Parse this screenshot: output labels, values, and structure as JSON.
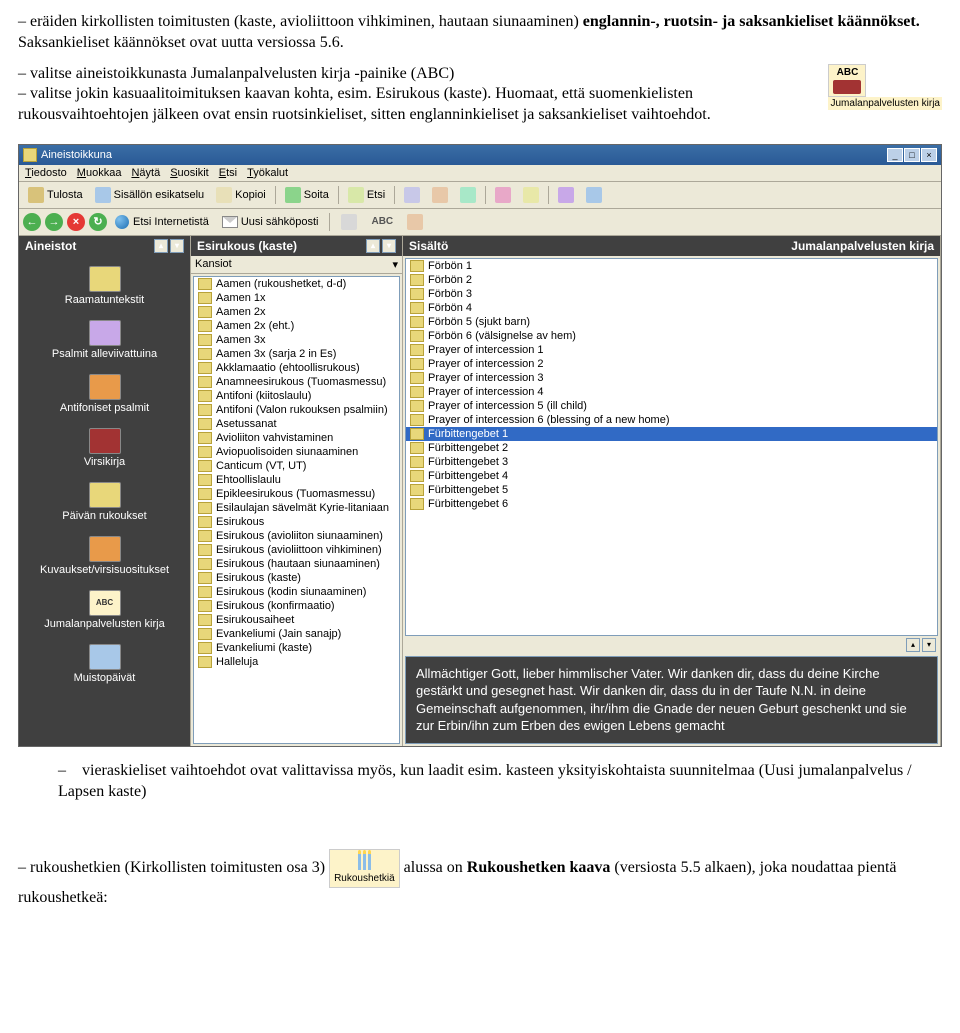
{
  "doc": {
    "p1a": "– eräiden kirkollisten toimitusten (kaste, avioliittoon vihkiminen, hautaan siunaaminen) ",
    "p1b": "englannin-, ruotsin- ja saksankieliset käännökset.",
    "p1c": " Saksankieliset käännökset ovat uutta versiossa 5.6.",
    "p2a": "– valitse aineistoikkunasta Jumalanpalvelusten kirja -painike (ABC)",
    "p2b": "– valitse jokin kasuaalitoimituksen kaavan kohta, esim. Esirukous (kaste). Huomaat, että suomenkielisten rukousvaihtoehtojen jälkeen ovat ensin ruotsinkieliset, sitten englanninkieliset ja saksankieliset vaihtoehdot.",
    "p3a": "–",
    "p3b": "vieraskieliset vaihtoehdot ovat valittavissa myös, kun laadit esim. kasteen yksityiskohtaista suunnitelmaa (Uusi jumalanpalvelus / Lapsen kaste)",
    "p4a": "– rukoushetkien (Kirkollisten toimitusten osa 3) ",
    "p4b": " alussa on ",
    "p4c": "Rukoushetken kaava",
    "p4d": " (versiosta 5.5 alkaen), joka noudattaa pientä rukoushetkeä:"
  },
  "abc_icon": {
    "abc": "ABC",
    "caption": "Jumalanpalvelusten kirja"
  },
  "prayer_icon": {
    "caption": "Rukoushetkiä"
  },
  "app": {
    "title": "Aineistoikkuna",
    "menus": [
      "Tiedosto",
      "Muokkaa",
      "Näytä",
      "Suosikit",
      "Etsi",
      "Työkalut"
    ],
    "toolbar": {
      "tulosta": "Tulosta",
      "esikatselu": "Sisällön esikatselu",
      "kopioi": "Kopioi",
      "soita": "Soita",
      "etsi": "Etsi"
    },
    "toolbar2": {
      "search_label": "Etsi Internetistä",
      "newmail": "Uusi sähköposti"
    },
    "sidebar": {
      "header": "Aineistot",
      "items": [
        "Raamatuntekstit",
        "Psalmit alleviivattuina",
        "Antifoniset psalmit",
        "Virsikirja",
        "Päivän rukoukset",
        "Kuvaukset/virsisuositukset",
        "Jumalanpalvelusten kirja",
        "Muistopäivät"
      ]
    },
    "col2": {
      "header": "Esirukous (kaste)",
      "sub": "Kansiot",
      "items": [
        "Aamen (rukoushetket, d-d)",
        "Aamen 1x",
        "Aamen 2x",
        "Aamen 2x (eht.)",
        "Aamen 3x",
        "Aamen 3x (sarja 2 in Es)",
        "Akklamaatio (ehtoollisrukous)",
        "Anamneesirukous (Tuomasmessu)",
        "Antifoni (kiitoslaulu)",
        "Antifoni (Valon rukouksen psalmiin)",
        "Asetussanat",
        "Avioliiton vahvistaminen",
        "Aviopuolisoiden siunaaminen",
        "Canticum (VT, UT)",
        "Ehtoollislaulu",
        "Epikleesirukous (Tuomasmessu)",
        "Esilaulajan sävelmät Kyrie-litaniaan",
        "Esirukous",
        "Esirukous (avioliiton siunaaminen)",
        "Esirukous (avioliittoon vihkiminen)",
        "Esirukous (hautaan siunaaminen)",
        "Esirukous (kaste)",
        "Esirukous (kodin siunaaminen)",
        "Esirukous (konfirmaatio)",
        "Esirukousaiheet",
        "Evankeliumi (Jain sanajp)",
        "Evankeliumi (kaste)",
        "Halleluja"
      ]
    },
    "col3": {
      "header_left": "Sisältö",
      "header_right": "Jumalanpalvelusten kirja",
      "items": [
        "Förbön 1",
        "Förbön 2",
        "Förbön 3",
        "Förbön 4",
        "Förbön 5 (sjukt barn)",
        "Förbön 6 (välsignelse av hem)",
        "Prayer of intercession 1",
        "Prayer of intercession 2",
        "Prayer of intercession 3",
        "Prayer of intercession 4",
        "Prayer of intercession 5 (ill child)",
        "Prayer of intercession 6 (blessing of a new home)",
        "Fürbittengebet 1",
        "Fürbittengebet 2",
        "Fürbittengebet 3",
        "Fürbittengebet 4",
        "Fürbittengebet 5",
        "Fürbittengebet 6"
      ],
      "selected_index": 12,
      "preview": "Allmächtiger Gott, lieber himmlischer Vater. Wir danken dir, dass du deine Kirche gestärkt und gesegnet hast. Wir danken dir, dass du in der Taufe N.N. in deine Gemeinschaft aufgenommen, ihr/ihm die Gnade der neuen Geburt geschenkt und sie zur Erbin/ihn zum Erben des ewigen Lebens gemacht"
    }
  }
}
